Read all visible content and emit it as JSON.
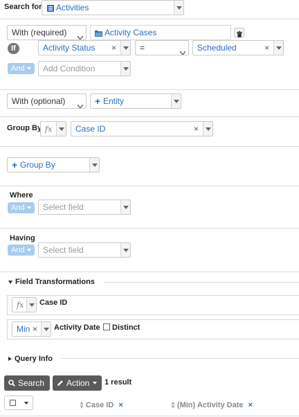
{
  "search_for": {
    "label": "Search for",
    "entity": "Activities"
  },
  "with_required": {
    "selector": "With (required)",
    "entity": "Activity Cases",
    "delete_icon": "trash-icon",
    "if_badge": "If",
    "condition": {
      "field": "Activity Status",
      "operator": "=",
      "value": "Scheduled"
    },
    "and_pill": "And",
    "add_condition_placeholder": "Add Condition"
  },
  "with_optional": {
    "selector": "With (optional)",
    "entity_button": "Entity"
  },
  "group_by": {
    "label": "Group By",
    "fx": "fx",
    "field": "Case ID",
    "add_button": "Group By"
  },
  "where": {
    "label": "Where",
    "and_pill": "And",
    "placeholder": "Select field"
  },
  "having": {
    "label": "Having",
    "and_pill": "And",
    "placeholder": "Select field"
  },
  "field_transformations": {
    "title": "Field Transformations",
    "row1": {
      "fx": "fx",
      "field": "Case ID"
    },
    "row2": {
      "func": "Min",
      "field": "Activity Date",
      "distinct_label": "Distinct"
    }
  },
  "query_info": {
    "title": "Query Info"
  },
  "actions": {
    "search": "Search",
    "action": "Action",
    "result_count": "1 result"
  },
  "results_header": {
    "col1": "Case ID",
    "col2": "(Min) Activity Date"
  },
  "colors": {
    "link_blue": "#2a6ebb",
    "dark_button": "#5a5a5a",
    "and_pill": "#a8cbef"
  }
}
